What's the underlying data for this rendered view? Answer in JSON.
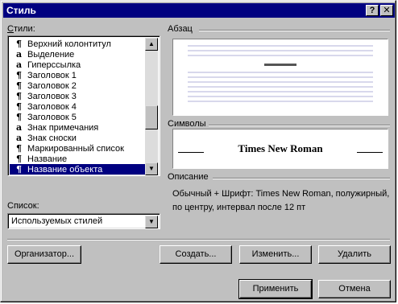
{
  "window": {
    "title": "Стиль",
    "help_button": "?",
    "close_button": "✕"
  },
  "styles_list": {
    "label_prefix": "С",
    "label_rest": "тили:",
    "items": [
      {
        "glyph": "¶",
        "label": "Верхний колонтитул",
        "selected": false
      },
      {
        "glyph": "a",
        "label": "Выделение",
        "selected": false
      },
      {
        "glyph": "a",
        "label": "Гиперссылка",
        "selected": false
      },
      {
        "glyph": "¶",
        "label": "Заголовок 1",
        "selected": false
      },
      {
        "glyph": "¶",
        "label": "Заголовок 2",
        "selected": false
      },
      {
        "glyph": "¶",
        "label": "Заголовок 3",
        "selected": false
      },
      {
        "glyph": "¶",
        "label": "Заголовок 4",
        "selected": false
      },
      {
        "glyph": "¶",
        "label": "Заголовок 5",
        "selected": false
      },
      {
        "glyph": "a",
        "label": "Знак примечания",
        "selected": false
      },
      {
        "glyph": "a",
        "label": "Знак сноски",
        "selected": false
      },
      {
        "glyph": "¶",
        "label": "Маркированный список",
        "selected": false
      },
      {
        "glyph": "¶",
        "label": "Название",
        "selected": false
      },
      {
        "glyph": "¶",
        "label": "Название объекта",
        "selected": true
      }
    ]
  },
  "list_filter": {
    "label_prefix": "Список",
    "label_rest": ":",
    "value": "Используемых стилей"
  },
  "paragraph_group": {
    "label": "Абзац"
  },
  "characters_group": {
    "label": "Символы",
    "font_name": "Times New Roman"
  },
  "description_group": {
    "label": "Описание",
    "text": "Обычный + Шрифт: Times New Roman, полужирный, по центру, интервал  после 12 пт"
  },
  "buttons": {
    "organizer": "Организатор...",
    "create": "Создать...",
    "modify": "Изменить...",
    "delete": "Удалить",
    "apply": "Применить",
    "cancel": "Отмена"
  },
  "colors": {
    "titlebar": "#000080",
    "selection": "#000080",
    "face": "#c0c0c0"
  }
}
